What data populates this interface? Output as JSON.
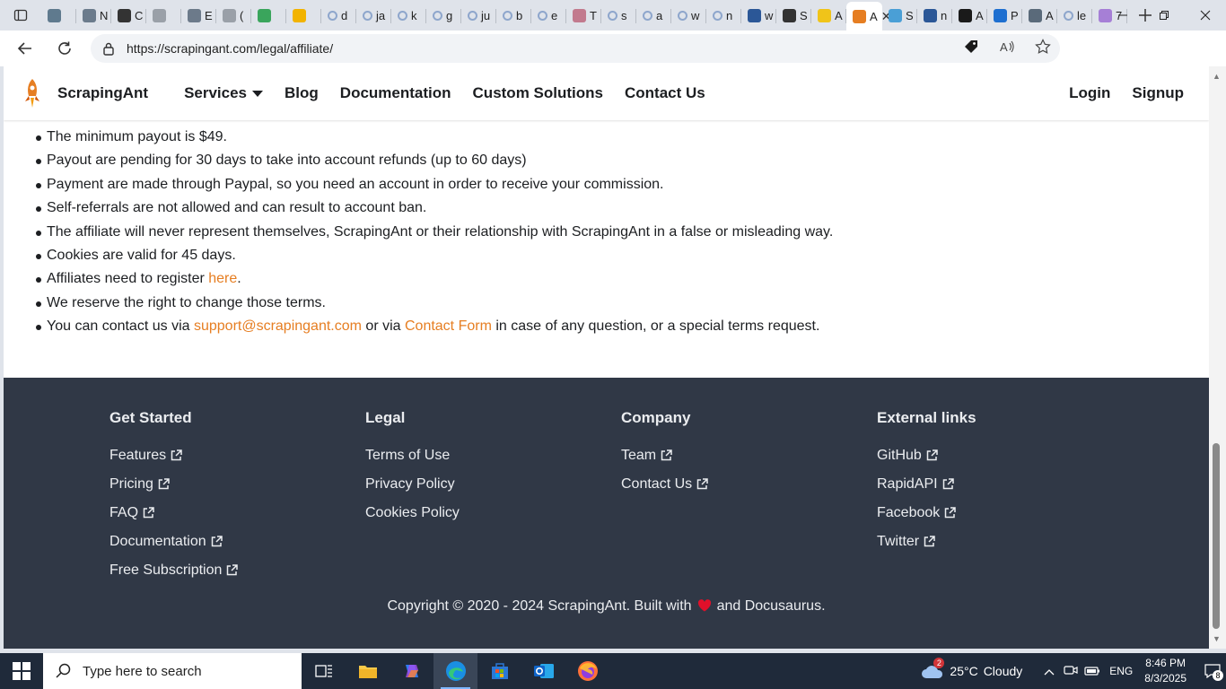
{
  "browser": {
    "url": "https://scrapingant.com/legal/affiliate/",
    "tabs": [
      {
        "label": "",
        "icon": "chart-icon",
        "color": "#5f7a8e"
      },
      {
        "label": "N",
        "icon": "n-icon",
        "color": "#6b7b8c"
      },
      {
        "label": "C",
        "icon": "openai-icon",
        "color": "#333333"
      },
      {
        "label": "",
        "icon": "n-badge-icon",
        "color": "#9aa0a8"
      },
      {
        "label": "E",
        "icon": "e-icon",
        "color": "#6c7a8a"
      },
      {
        "label": "(",
        "icon": "grey-circle-icon",
        "color": "#9aa0a8"
      },
      {
        "label": "",
        "icon": "green-ball-icon",
        "color": "#3aa55c"
      },
      {
        "label": "",
        "icon": "yellow-y-icon",
        "color": "#f2b300"
      },
      {
        "label": "d",
        "icon": "search-icon",
        "color": "#8ea6cc"
      },
      {
        "label": "ja",
        "icon": "search-icon",
        "color": "#8ea6cc"
      },
      {
        "label": "k",
        "icon": "search-icon",
        "color": "#8ea6cc"
      },
      {
        "label": "g",
        "icon": "search-icon",
        "color": "#8ea6cc"
      },
      {
        "label": "ju",
        "icon": "search-icon",
        "color": "#8ea6cc"
      },
      {
        "label": "b",
        "icon": "search-icon",
        "color": "#8ea6cc"
      },
      {
        "label": "e",
        "icon": "search-icon",
        "color": "#8ea6cc"
      },
      {
        "label": "T",
        "icon": "pink-grid-icon",
        "color": "#c27a8e"
      },
      {
        "label": "s",
        "icon": "search-icon",
        "color": "#8ea6cc"
      },
      {
        "label": "a",
        "icon": "search-icon",
        "color": "#8ea6cc"
      },
      {
        "label": "w",
        "icon": "search-icon",
        "color": "#8ea6cc"
      },
      {
        "label": "n",
        "icon": "search-icon",
        "color": "#8ea6cc"
      },
      {
        "label": "w",
        "icon": "search-dark-icon",
        "color": "#2b5797"
      },
      {
        "label": "S",
        "icon": "eye-icon",
        "color": "#333333"
      },
      {
        "label": "A",
        "icon": "yellow-bird-icon",
        "color": "#f0c419"
      },
      {
        "label": "A",
        "icon": "ant-icon",
        "color": "#e67e22",
        "active": true
      },
      {
        "label": "S",
        "icon": "swirl-icon",
        "color": "#4a9fd6"
      },
      {
        "label": "n",
        "icon": "search-dark-icon",
        "color": "#2b5797"
      },
      {
        "label": "A",
        "icon": "ip-icon",
        "color": "#1a1a1a"
      },
      {
        "label": "P",
        "icon": "xf-icon",
        "color": "#1e6fd0"
      },
      {
        "label": "A",
        "icon": "hat-icon",
        "color": "#5a6a7a"
      },
      {
        "label": "le",
        "icon": "search-icon",
        "color": "#8ea6cc"
      },
      {
        "label": "7",
        "icon": "purple-gear-icon",
        "color": "#a67fd6"
      }
    ]
  },
  "site": {
    "brand": "ScrapingAnt",
    "brand_color": "#e67e22",
    "nav": {
      "services": "Services",
      "blog": "Blog",
      "documentation": "Documentation",
      "custom_solutions": "Custom Solutions",
      "contact": "Contact Us",
      "login": "Login",
      "signup": "Signup"
    },
    "terms": {
      "t1": "The minimum payout is $49.",
      "t2": "Payout are pending for 30 days to take into account refunds (up to 60 days)",
      "t3": "Payment are made through Paypal, so you need an account in order to receive your commission.",
      "t4": "Self-referrals are not allowed and can result to account ban.",
      "t5": "The affiliate will never represent themselves, ScrapingAnt or their relationship with ScrapingAnt in a false or misleading way.",
      "t6": "Cookies are valid for 45 days.",
      "t7_before": "Affiliates need to register ",
      "t7_link": "here",
      "t7_after": ".",
      "t8": "We reserve the right to change those terms.",
      "t9_before": "You can contact us via ",
      "t9_email": "support@scrapingant.com",
      "t9_mid": " or via ",
      "t9_link": "Contact Form",
      "t9_after": " in case of any question, or a special terms request."
    },
    "footer": {
      "get_started": {
        "title": "Get Started",
        "links": [
          "Features",
          "Pricing",
          "FAQ",
          "Documentation",
          "Free Subscription"
        ]
      },
      "legal": {
        "title": "Legal",
        "links": [
          "Terms of Use",
          "Privacy Policy",
          "Cookies Policy"
        ]
      },
      "company": {
        "title": "Company",
        "links": [
          "Team",
          "Contact Us"
        ]
      },
      "external": {
        "title": "External links",
        "links": [
          "GitHub",
          "RapidAPI",
          "Facebook",
          "Twitter"
        ]
      },
      "copyright_before": "Copyright © 2020 - 2024 ScrapingAnt. Built with",
      "copyright_after": "and Docusaurus."
    }
  },
  "taskbar": {
    "search_placeholder": "Type here to search",
    "weather_temp": "25°C",
    "weather_text": "Cloudy",
    "weather_badge": "2",
    "language": "ENG",
    "time": "8:46 PM",
    "date": "8/3/2025",
    "notification_count": "8"
  }
}
